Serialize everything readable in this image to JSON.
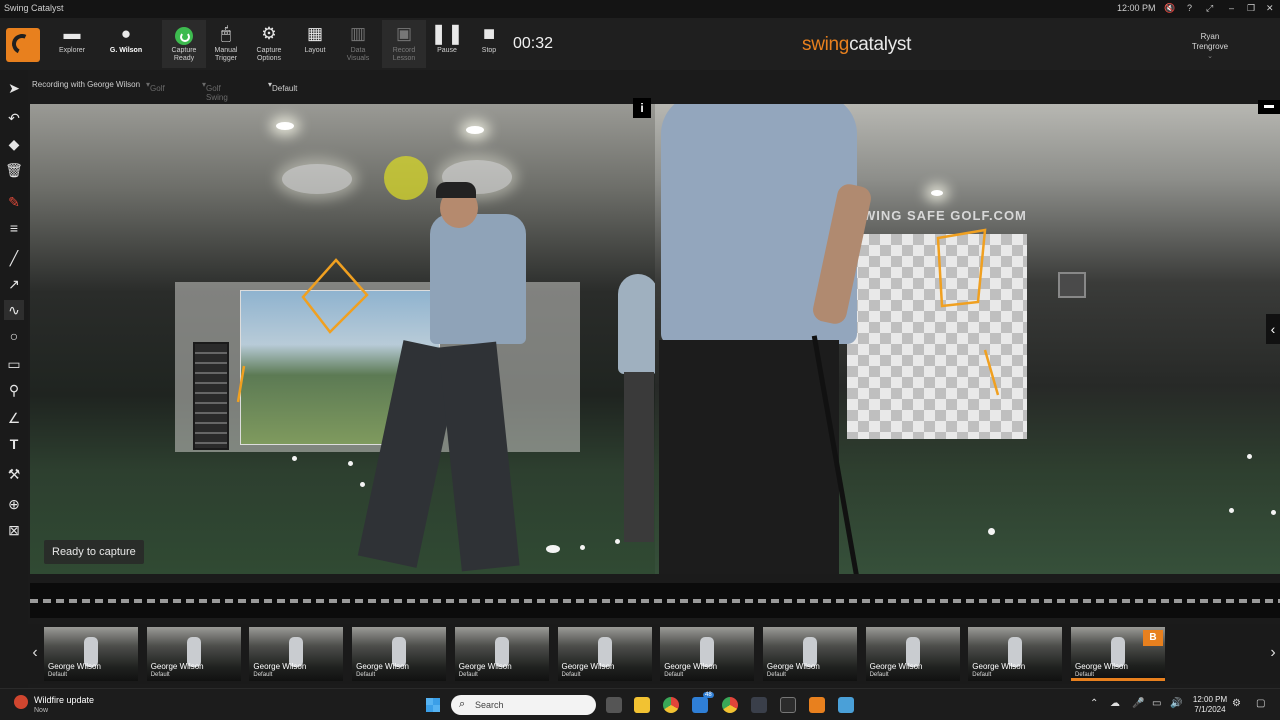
{
  "window": {
    "title": "Swing Catalyst",
    "clock": "12:00 PM"
  },
  "toolbar": {
    "explorer": "Explorer",
    "user_short": "G. Wilson",
    "capture_ready": [
      "Capture",
      "Ready"
    ],
    "manual_trigger": [
      "Manual",
      "Trigger"
    ],
    "capture_options": [
      "Capture",
      "Options"
    ],
    "layout": "Layout",
    "data_visuals": [
      "Data",
      "Visuals"
    ],
    "record_lesson": [
      "Record",
      "Lesson"
    ],
    "pause": "Pause",
    "stop": "Stop",
    "timer": "00:32",
    "brand_left": "swing",
    "brand_right": "catalyst",
    "operator_first": "Ryan",
    "operator_last": "Trengrove"
  },
  "subbar": {
    "recording": "Recording with George Wilson",
    "sport": "Golf",
    "activity": "Golf Swing",
    "preset": "Default"
  },
  "video": {
    "status": "Ready to capture",
    "info_icon": "i",
    "right_wall_sign": "WING SAFE GOLF.COM"
  },
  "thumbnails": [
    {
      "name": "George Wilson",
      "sub": "Default"
    },
    {
      "name": "George Wilson",
      "sub": "Default"
    },
    {
      "name": "George Wilson",
      "sub": "Default"
    },
    {
      "name": "George Wilson",
      "sub": "Default"
    },
    {
      "name": "George Wilson",
      "sub": "Default"
    },
    {
      "name": "George Wilson",
      "sub": "Default"
    },
    {
      "name": "George Wilson",
      "sub": "Default"
    },
    {
      "name": "George Wilson",
      "sub": "Default"
    },
    {
      "name": "George Wilson",
      "sub": "Default"
    },
    {
      "name": "George Wilson",
      "sub": "Default"
    },
    {
      "name": "George Wilson",
      "sub": "Default"
    }
  ],
  "badge": "B",
  "taskbar": {
    "notif_title": "Wildfire update",
    "notif_sub": "Now",
    "search_placeholder": "Search",
    "time": "12:00 PM",
    "date": "7/1/2024",
    "mail_badge": "48"
  },
  "colors": {
    "accent": "#e8801e",
    "ready": "#3dbb4f",
    "annotation": "#f0a020"
  }
}
